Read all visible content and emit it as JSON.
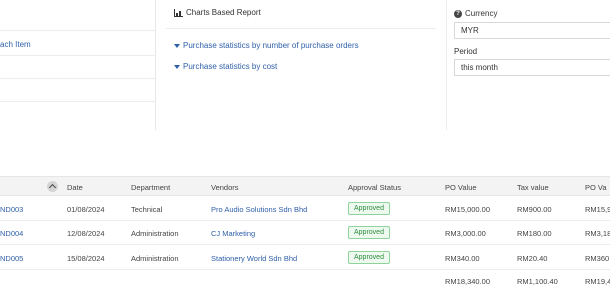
{
  "report": {
    "left_link": "ach Item",
    "chart_section_title": "Charts Based Report",
    "chart_links": [
      "Purchase statistics by number of purchase orders",
      "Purchase statistics by cost"
    ],
    "currency_label": "Currency",
    "currency_value": "MYR",
    "period_label": "Period",
    "period_value": "this month"
  },
  "table": {
    "columns": [
      "Date",
      "Department",
      "Vendors",
      "Approval Status",
      "PO Value",
      "Tax value",
      "PO Va"
    ],
    "rows": [
      {
        "id": "ND003",
        "date": "01/08/2024",
        "department": "Technical",
        "vendor": "Pro Audio Solutions Sdn Bhd",
        "status": "Approved",
        "po_value": "RM15,000.00",
        "tax": "RM900.00",
        "po_total": "RM15,9"
      },
      {
        "id": "ND004",
        "date": "12/08/2024",
        "department": "Administration",
        "vendor": "CJ Marketing",
        "status": "Approved",
        "po_value": "RM3,000.00",
        "tax": "RM180.00",
        "po_total": "RM3,18"
      },
      {
        "id": "ND005",
        "date": "15/08/2024",
        "department": "Administration",
        "vendor": "Stationery World Sdn Bhd",
        "status": "Approved",
        "po_value": "RM340.00",
        "tax": "RM20.40",
        "po_total": "RM360"
      }
    ],
    "totals": {
      "po_value": "RM18,340.00",
      "tax": "RM1,100.40",
      "po_total": "RM19,4"
    }
  }
}
